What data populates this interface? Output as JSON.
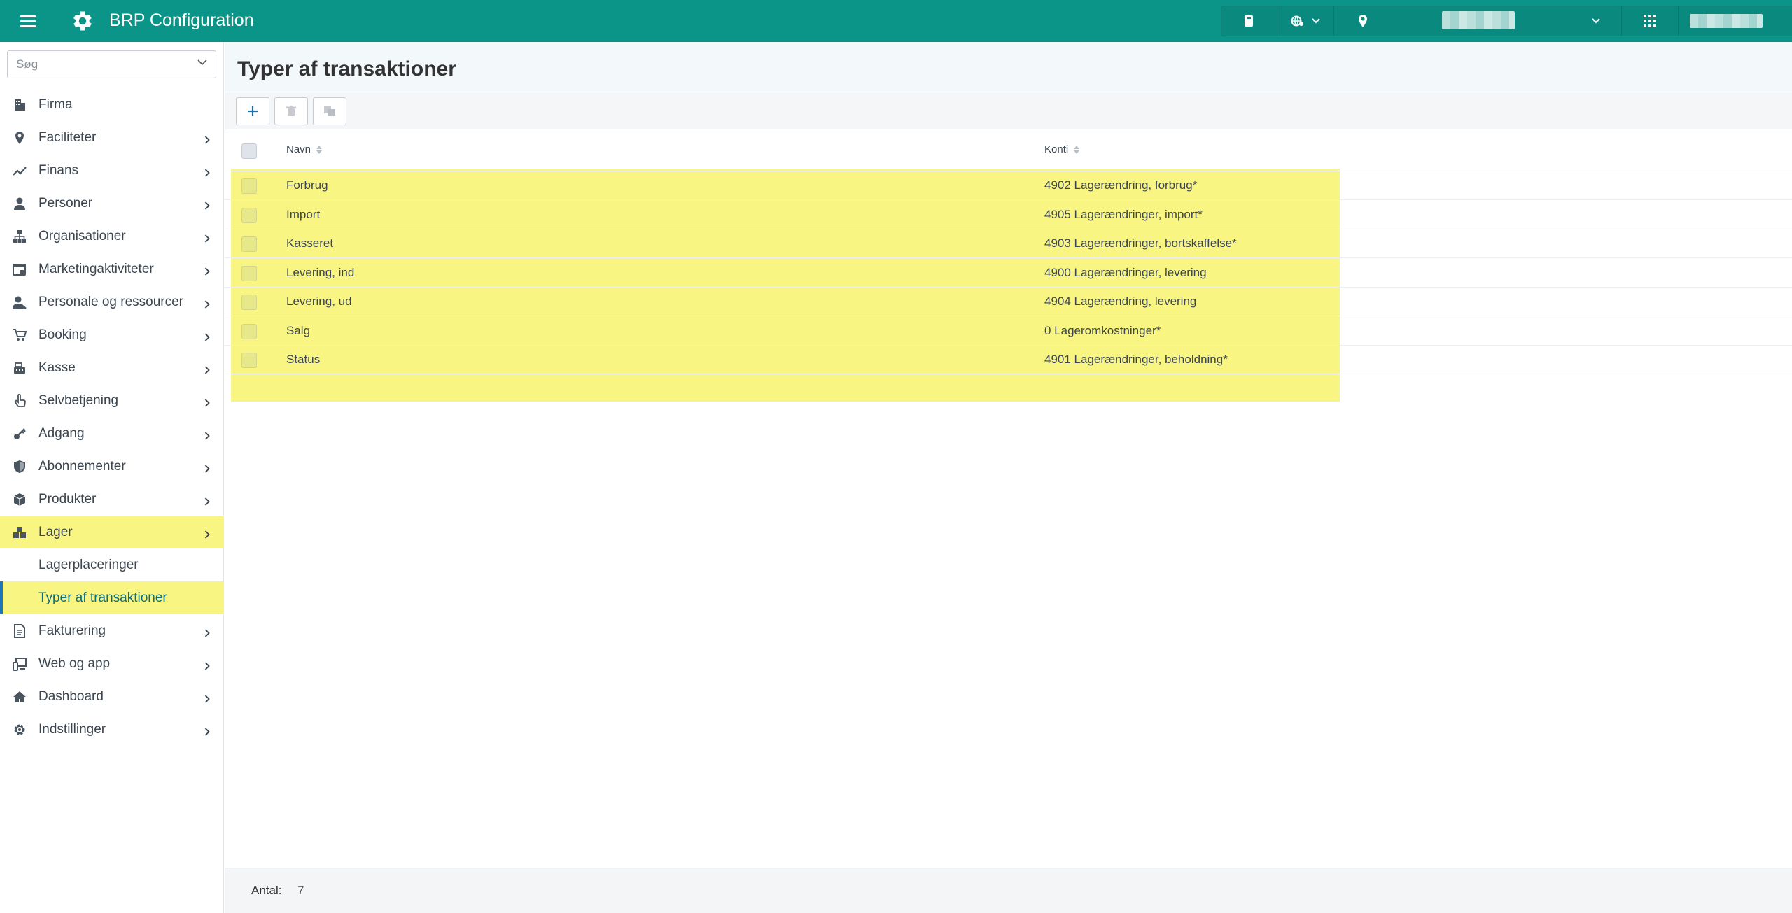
{
  "app": {
    "title": "BRP Configuration",
    "accent": "#0b9488",
    "highlight": "#f8f582"
  },
  "sidebar": {
    "search_placeholder": "Søg",
    "items": [
      {
        "label": "Firma",
        "icon": "building-icon",
        "arrow": false
      },
      {
        "label": "Faciliteter",
        "icon": "map-pin-icon",
        "arrow": true
      },
      {
        "label": "Finans",
        "icon": "trend-line-icon",
        "arrow": true
      },
      {
        "label": "Personer",
        "icon": "person-icon",
        "arrow": true
      },
      {
        "label": "Organisationer",
        "icon": "org-chart-icon",
        "arrow": true
      },
      {
        "label": "Marketingaktiviteter",
        "icon": "calendar-icon",
        "arrow": true
      },
      {
        "label": "Personale og ressourcer",
        "icon": "staff-icon",
        "arrow": true
      },
      {
        "label": "Booking",
        "icon": "cart-icon",
        "arrow": true
      },
      {
        "label": "Kasse",
        "icon": "cash-register-icon",
        "arrow": true
      },
      {
        "label": "Selvbetjening",
        "icon": "hand-pointer-icon",
        "arrow": true
      },
      {
        "label": "Adgang",
        "icon": "key-icon",
        "arrow": true
      },
      {
        "label": "Abonnementer",
        "icon": "shield-icon",
        "arrow": true
      },
      {
        "label": "Produkter",
        "icon": "box-icon",
        "arrow": true
      },
      {
        "label": "Lager",
        "icon": "boxes-icon",
        "arrow": true,
        "highlight": true
      }
    ],
    "lager_sub": [
      "Lagerplaceringer",
      "Typer af transaktioner"
    ],
    "items_after": [
      {
        "label": "Fakturering",
        "icon": "invoice-icon",
        "arrow": true
      },
      {
        "label": "Web og app",
        "icon": "devices-icon",
        "arrow": true
      },
      {
        "label": "Dashboard",
        "icon": "home-icon",
        "arrow": true
      },
      {
        "label": "Indstillinger",
        "icon": "gear-icon",
        "arrow": true
      }
    ]
  },
  "page": {
    "title": "Typer af transaktioner"
  },
  "table": {
    "columns": [
      "Navn",
      "Konti"
    ],
    "rows": [
      [
        "Forbrug",
        "4902 Lagerændring, forbrug*"
      ],
      [
        "Import",
        "4905 Lagerændringer, import*"
      ],
      [
        "Kasseret",
        "4903 Lagerændringer, bortskaffelse*"
      ],
      [
        "Levering, ind",
        "4900 Lagerændringer, levering"
      ],
      [
        "Levering, ud",
        "4904 Lagerændring, levering"
      ],
      [
        "Salg",
        "0 Lageromkostninger*"
      ],
      [
        "Status",
        "4901 Lagerændringer, beholdning*"
      ]
    ]
  },
  "footer": {
    "count_label": "Antal:",
    "count_value": "7"
  }
}
